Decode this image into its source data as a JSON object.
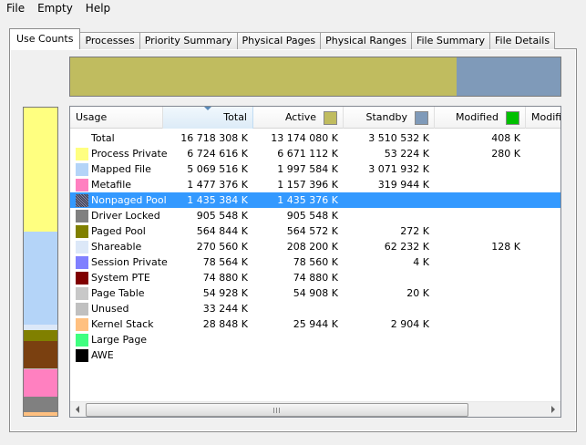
{
  "menu": [
    "File",
    "Empty",
    "Help"
  ],
  "tabs": [
    "Use Counts",
    "Processes",
    "Priority Summary",
    "Physical Pages",
    "Physical Ranges",
    "File Summary",
    "File Details"
  ],
  "columns": {
    "usage": "Usage",
    "total": "Total",
    "active": "Active",
    "standby": "Standby",
    "modified": "Modified",
    "modified_nowrite": "Modifi"
  },
  "column_colors": {
    "active": "#c0bc5f",
    "standby": "#7f9ab9",
    "modified": "#00c000"
  },
  "rows": [
    {
      "label": "Total",
      "color": "",
      "total": "16 718 308 K",
      "active": "13 174 080 K",
      "standby": "3 510 532 K",
      "modified": "408 K"
    },
    {
      "label": "Process Private",
      "color": "#ffff80",
      "total": "6 724 616 K",
      "active": "6 671 112 K",
      "standby": "53 224 K",
      "modified": "280 K"
    },
    {
      "label": "Mapped File",
      "color": "#b4d4f8",
      "total": "5 069 516 K",
      "active": "1 997 584 K",
      "standby": "3 071 932 K",
      "modified": ""
    },
    {
      "label": "Metafile",
      "color": "#ff80c0",
      "total": "1 477 376 K",
      "active": "1 157 396 K",
      "standby": "319 944 K",
      "modified": ""
    },
    {
      "label": "Nonpaged Pool",
      "color": "hatch",
      "total": "1 435 384 K",
      "active": "1 435 376 K",
      "standby": "",
      "modified": "",
      "selected": true
    },
    {
      "label": "Driver Locked",
      "color": "#808080",
      "total": "905 548 K",
      "active": "905 548 K",
      "standby": "",
      "modified": ""
    },
    {
      "label": "Paged Pool",
      "color": "#808000",
      "total": "564 844 K",
      "active": "564 572 K",
      "standby": "272 K",
      "modified": ""
    },
    {
      "label": "Shareable",
      "color": "#dce8f8",
      "total": "270 560 K",
      "active": "208 200 K",
      "standby": "62 232 K",
      "modified": "128 K"
    },
    {
      "label": "Session Private",
      "color": "#8080ff",
      "total": "78 564 K",
      "active": "78 560 K",
      "standby": "4 K",
      "modified": ""
    },
    {
      "label": "System PTE",
      "color": "#800000",
      "total": "74 880 K",
      "active": "74 880 K",
      "standby": "",
      "modified": ""
    },
    {
      "label": "Page Table",
      "color": "#c8c8c8",
      "total": "54 928 K",
      "active": "54 908 K",
      "standby": "20 K",
      "modified": ""
    },
    {
      "label": "Unused",
      "color": "#c0c0c0",
      "total": "33 244 K",
      "active": "",
      "standby": "",
      "modified": ""
    },
    {
      "label": "Kernel Stack",
      "color": "#ffc080",
      "total": "28 848 K",
      "active": "25 944 K",
      "standby": "2 904 K",
      "modified": ""
    },
    {
      "label": "Large Page",
      "color": "#40ff80",
      "total": "",
      "active": "",
      "standby": "",
      "modified": ""
    },
    {
      "label": "AWE",
      "color": "#000000",
      "total": "",
      "active": "",
      "standby": "",
      "modified": ""
    }
  ],
  "topbar": [
    {
      "name": "active",
      "fraction": 0.788,
      "color": "#c0bc5f"
    },
    {
      "name": "standby",
      "fraction": 0.212,
      "color": "#7f9ab9"
    }
  ],
  "sidebar": [
    {
      "name": "process-private",
      "fraction": 0.402,
      "color": "#ffff80"
    },
    {
      "name": "mapped-file",
      "fraction": 0.303,
      "color": "#b4d4f8"
    },
    {
      "name": "separator",
      "fraction": 0.018,
      "color": "#dce8f8"
    },
    {
      "name": "paged-pool",
      "fraction": 0.034,
      "color": "#808000"
    },
    {
      "name": "kernel-brown",
      "fraction": 0.088,
      "color": "#7a4010"
    },
    {
      "name": "separator2",
      "fraction": 0.003,
      "color": "#c0c0c0"
    },
    {
      "name": "metafile",
      "fraction": 0.091,
      "color": "#ff80c0"
    },
    {
      "name": "driver-locked",
      "fraction": 0.05,
      "color": "#808080"
    },
    {
      "name": "tail",
      "fraction": 0.011,
      "color": "#ffc080"
    }
  ]
}
